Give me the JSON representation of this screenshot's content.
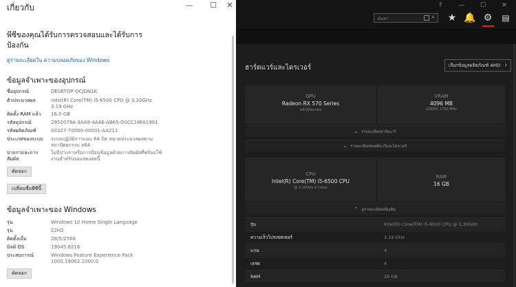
{
  "about": {
    "title": "เกี่ยวกับ",
    "window_controls": {
      "minimize": "—",
      "maximize": "☐",
      "close": "✕"
    },
    "heading": "พีซีของคุณได้รับการตรวจสอบและได้รับการป้องกัน",
    "link": "ดูรายละเอียดใน ความปลอดภัยของ Windows",
    "device_section": "ข้อมูลจำเพาะของอุปกรณ์",
    "device_specs": [
      {
        "k": "ชื่ออุปกรณ์",
        "v": "DESKTOP-OCJON1K"
      },
      {
        "k": "ตัวประมวลผล",
        "v": "Intel(R) Core(TM) i5-6500 CPU @ 3.20GHz 3.19 GHz"
      },
      {
        "k": "ติดตั้ง RAM แล้ว",
        "v": "16.0 GB"
      },
      {
        "k": "รหัสอุปกรณ์",
        "v": "2952079A-3AA9-4A4E-AB65-D0CC18FA1991"
      },
      {
        "k": "รหัสผลิตภัณฑ์",
        "v": "00327-70000-00001-AA211"
      },
      {
        "k": "ประเภทของระบบ",
        "v": "ระบบปฏิบัติการแบบ 64 บิต หน่วยประมวลผลตามสถาปัตยกรรม x64"
      },
      {
        "k": "ปากกาและการสัมผัส",
        "v": "ไม่มีปากกาหรือการป้อนข้อมูลด้วยการสัมผัสที่พร้อมใช้งานสำหรับจอแสดงผลนี้"
      }
    ],
    "copy_button": "คัดลอก",
    "rename_button": "เปลี่ยนชื่อพีซีนี้",
    "windows_section": "ข้อมูลจำเพาะของ Windows",
    "windows_specs": [
      {
        "k": "รุ่น",
        "v": "Windows 10 Home Single Language"
      },
      {
        "k": "รุ่น",
        "v": "22H2"
      },
      {
        "k": "ติดตั้งเมื่อ",
        "v": "28/5/2566"
      },
      {
        "k": "บิลด์ OS",
        "v": "19045.6216"
      },
      {
        "k": "ประสบการณ์",
        "v": "Windows Feature Experience Pack 1000.19062.1000.0"
      }
    ],
    "copy_button_2": "คัดลอก"
  },
  "amd": {
    "window_controls": {
      "help": "?",
      "minimize": "—",
      "maximize": "☐",
      "close": "✕"
    },
    "search_placeholder": "ค้นหา",
    "section_title": "ฮาร์ดแวร์และไดรเวอร์",
    "amd_button": "เลือกข้อมูลผลิตภัณฑ์ AMD",
    "gpu": {
      "label": "GPU",
      "value": "Radeon RX 570 Series",
      "sub": "หลัก/Discrete"
    },
    "vram": {
      "label": "VRAM",
      "value": "4096 MB",
      "sub": "GDDR5 1750 MHz"
    },
    "expander_hw": "รายละเอียดฮาร์ดแวร์",
    "expander_sw": "รายละเอียดซอฟต์แวร์และไดรเวอร์",
    "cpu": {
      "label": "CPU",
      "value": "Intel(R) Core(TM) i5-6500 CPU",
      "sub": "@ 3.20GHz 4 Cores"
    },
    "ram": {
      "label": "RAM",
      "value": "16 GB"
    },
    "expander_more": "ดูรายละเอียดเพิ่มเติม",
    "table": [
      {
        "k": "รุ่น",
        "v": "Intel(R) Core(TM) i5-6500 CPU @ 3.20GHz"
      },
      {
        "k": "ความเร็วโปรเซสเซอร์",
        "v": "3.19 GHz"
      },
      {
        "k": "แกน",
        "v": "4"
      },
      {
        "k": "เธรด",
        "v": "4"
      },
      {
        "k": "RAM",
        "v": "16 GB"
      }
    ],
    "colors": {
      "accent": "#e0262c",
      "background": "#1d1d1d"
    }
  }
}
